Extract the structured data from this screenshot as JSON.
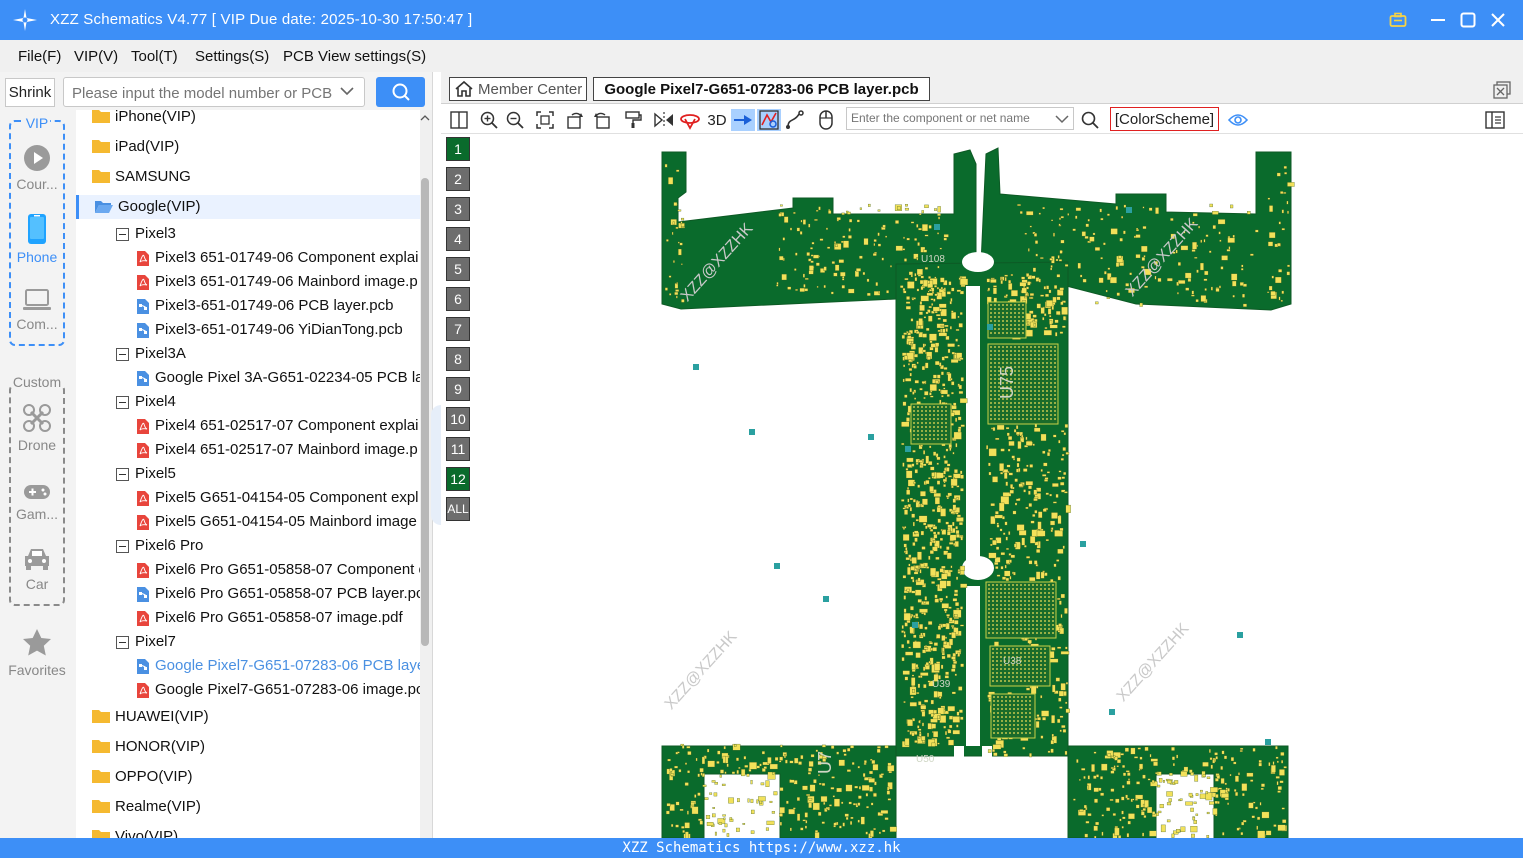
{
  "app": {
    "title": "XZZ Schematics V4.77 [ VIP Due date: 2025-10-30 17:50:47 ]",
    "accent": "#3d8ff7"
  },
  "menu": [
    "File(F)",
    "VIP(V)",
    "Tool(T)",
    "Settings(S)",
    "PCB View settings(S)"
  ],
  "left": {
    "shrink_label": "Shrink",
    "search_placeholder": "Please input the model number or PCB",
    "vip_label": "VIP",
    "custom_label": "Custom",
    "categories": [
      {
        "label": "Cour...",
        "icon": "play-circle-icon"
      },
      {
        "label": "Phone",
        "icon": "phone-icon"
      },
      {
        "label": "Com...",
        "icon": "laptop-icon"
      },
      {
        "label": "Drone",
        "icon": "drone-icon"
      },
      {
        "label": "Gam...",
        "icon": "gamepad-icon"
      },
      {
        "label": "Car",
        "icon": "car-icon"
      },
      {
        "label": "Favorites",
        "icon": "star-icon"
      }
    ]
  },
  "tree": {
    "brands_top": [
      "iPhone(VIP)",
      "iPad(VIP)",
      "SAMSUNG",
      "Google(VIP)"
    ],
    "google_models": [
      {
        "name": "Pixel3",
        "files": [
          {
            "name": "Pixel3 651-01749-06 Component explai",
            "type": "pdf"
          },
          {
            "name": "Pixel3 651-01749-06 Mainbord image.p",
            "type": "pdf"
          },
          {
            "name": "Pixel3-651-01749-06 PCB layer.pcb",
            "type": "pcb"
          },
          {
            "name": "Pixel3-651-01749-06 YiDianTong.pcb",
            "type": "pcb"
          }
        ]
      },
      {
        "name": "Pixel3A",
        "files": [
          {
            "name": "Google Pixel 3A-G651-02234-05 PCB la",
            "type": "pcb"
          }
        ]
      },
      {
        "name": "Pixel4",
        "files": [
          {
            "name": "Pixel4 651-02517-07 Component explai",
            "type": "pdf"
          },
          {
            "name": "Pixel4 651-02517-07 Mainbord image.p",
            "type": "pdf"
          }
        ]
      },
      {
        "name": "Pixel5",
        "files": [
          {
            "name": "Pixel5 G651-04154-05 Component expl",
            "type": "pdf"
          },
          {
            "name": "Pixel5 G651-04154-05 Mainbord image",
            "type": "pdf"
          }
        ]
      },
      {
        "name": "Pixel6 Pro",
        "files": [
          {
            "name": "Pixel6 Pro G651-05858-07 Component e",
            "type": "pdf"
          },
          {
            "name": "Pixel6 Pro G651-05858-07 PCB layer.pcb",
            "type": "pcb"
          },
          {
            "name": "Pixel6 Pro G651-05858-07 image.pdf",
            "type": "pdf"
          }
        ]
      },
      {
        "name": "Pixel7",
        "files": [
          {
            "name": "Google Pixel7-G651-07283-06 PCB laye",
            "type": "pcb",
            "active": true
          },
          {
            "name": "Google Pixel7-G651-07283-06 image.pc",
            "type": "pdf"
          }
        ]
      }
    ],
    "brands_bottom": [
      "HUAWEI(VIP)",
      "HONOR(VIP)",
      "OPPO(VIP)",
      "Realme(VIP)",
      "Vivo(VIP)"
    ]
  },
  "tabs": {
    "home": "Member Center",
    "active": "Google Pixel7-G651-07283-06 PCB layer.pcb"
  },
  "toolbar": {
    "label_3d": "3D",
    "search_placeholder": "Enter the component or net name",
    "colorscheme": "[ColorScheme]"
  },
  "layers": [
    "1",
    "2",
    "3",
    "4",
    "5",
    "6",
    "7",
    "8",
    "9",
    "10",
    "11",
    "12",
    "ALL"
  ],
  "active_layers": [
    "1",
    "12"
  ],
  "board": {
    "watermark": "XZZ@XZZHK",
    "labels": [
      "U108",
      "U75",
      "U38",
      "U39",
      "U50",
      "U7"
    ],
    "green": "#0a6b2c",
    "pad": "#f2e15a"
  },
  "status": "XZZ Schematics https://www.xzz.hk"
}
